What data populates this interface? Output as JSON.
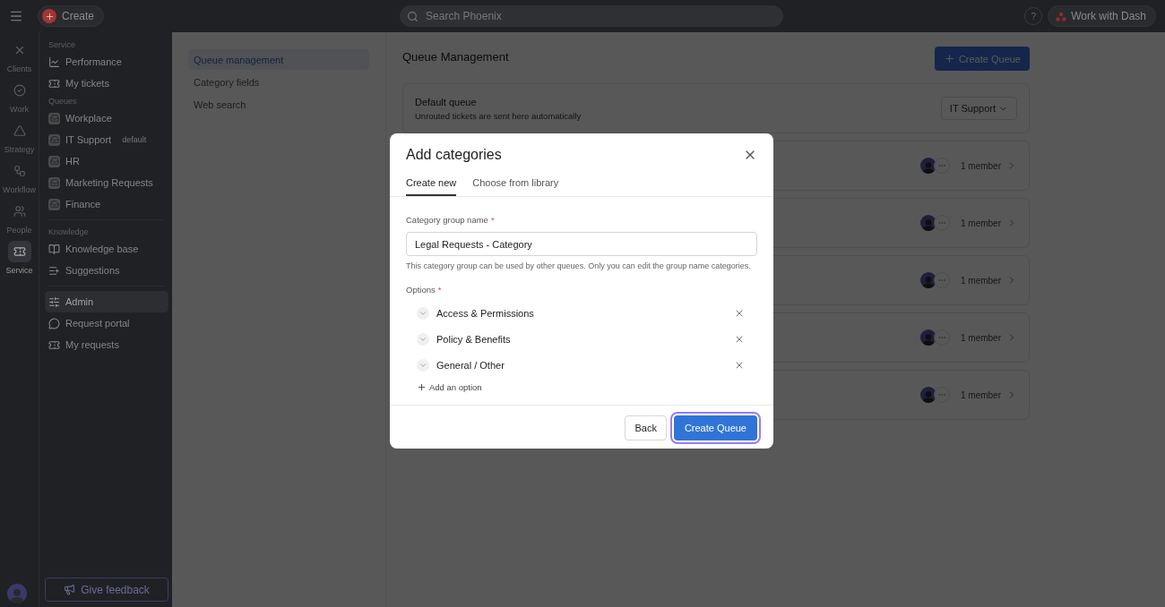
{
  "top_bar": {
    "create_button": "Create",
    "search": {
      "placeholder": "Search Phoenix"
    },
    "help_button": "?",
    "dash_button": "Work with Dash"
  },
  "rail": {
    "items": [
      {
        "label": "Clients",
        "selected": false
      },
      {
        "label": "Work",
        "selected": false
      },
      {
        "label": "Strategy",
        "selected": false
      },
      {
        "label": "Workflow",
        "selected": false
      },
      {
        "label": "People",
        "selected": false
      },
      {
        "label": "Service",
        "selected": true
      }
    ]
  },
  "sidebar": {
    "sections": [
      {
        "heading": "Service",
        "items": [
          {
            "label": "Performance",
            "selected": false
          },
          {
            "label": "My tickets",
            "selected": false
          }
        ]
      },
      {
        "heading": "Queues",
        "items": [
          {
            "label": "Workplace",
            "selected": false
          },
          {
            "label": "IT Support",
            "badge": "default",
            "selected": false
          },
          {
            "label": "HR",
            "selected": false
          },
          {
            "label": "Marketing Requests",
            "selected": false
          },
          {
            "label": "Finance",
            "selected": false
          }
        ]
      },
      {
        "heading": "Knowledge",
        "items": [
          {
            "label": "Knowledge base",
            "selected": false
          },
          {
            "label": "Suggestions",
            "selected": false
          }
        ]
      },
      {
        "items": [
          {
            "label": "Admin",
            "selected": true
          },
          {
            "label": "Request portal",
            "selected": false
          },
          {
            "label": "My requests",
            "selected": false
          }
        ]
      }
    ],
    "feedback_button": "Give feedback"
  },
  "subnav": {
    "items": [
      {
        "label": "Queue management",
        "selected": true
      },
      {
        "label": "Category fields",
        "selected": false
      },
      {
        "label": "Web search",
        "selected": false
      }
    ]
  },
  "main": {
    "title": "Queue Management",
    "create_button": "Create Queue",
    "default_queue": {
      "title": "Default queue",
      "subtitle": "Unrouted tickets are sent here automatically",
      "select": "IT Support"
    },
    "queues": [
      {
        "members": "1 member"
      },
      {
        "members": "1 member"
      },
      {
        "members": "1 member"
      },
      {
        "members": "1 member"
      },
      {
        "members": "1 member"
      }
    ]
  },
  "modal": {
    "title": "Add categories",
    "tabs": [
      {
        "label": "Create new",
        "selected": true
      },
      {
        "label": "Choose from library",
        "selected": false
      }
    ],
    "name_field": {
      "label": "Category group name",
      "required_mark": "*",
      "value": "Legal Requests - Category",
      "help": "This category group can be used by other queues. Only you can edit the group name categories."
    },
    "options_label": "Options",
    "options_required_mark": "*",
    "options": [
      "Access & Permissions",
      "Policy & Benefits",
      "General / Other"
    ],
    "add_option": "Add an option",
    "back_button": "Back",
    "create_button": {
      "label": "Create Queue",
      "focused": true
    }
  }
}
